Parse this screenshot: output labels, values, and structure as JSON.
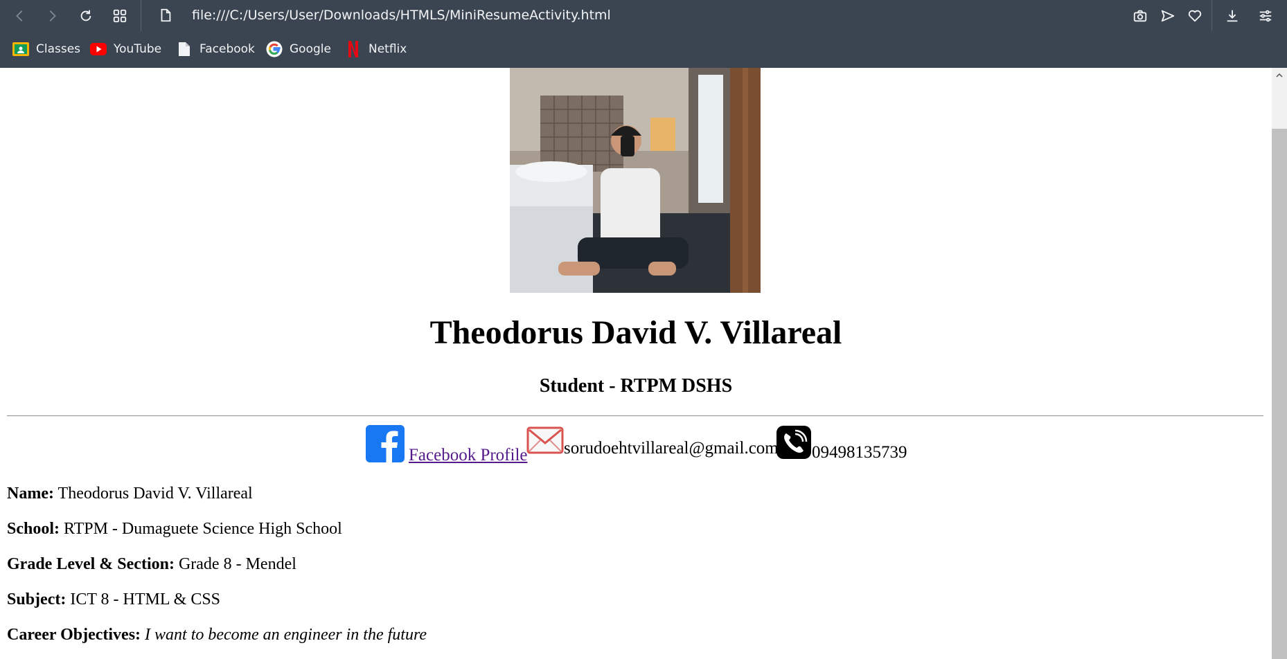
{
  "browser": {
    "url": "file:///C:/Users/User/Downloads/HTMLS/MiniResumeActivity.html",
    "bookmarks": [
      {
        "label": "Classes",
        "icon": "google-classroom-icon"
      },
      {
        "label": "YouTube",
        "icon": "youtube-icon"
      },
      {
        "label": "Facebook",
        "icon": "page-icon"
      },
      {
        "label": "Google",
        "icon": "google-icon"
      },
      {
        "label": "Netflix",
        "icon": "netflix-icon"
      }
    ]
  },
  "profile": {
    "full_name": "Theodorus David V. Villareal",
    "role": "Student - RTPM DSHS",
    "facebook_label": "Facebook Profile",
    "email": "sorudoehtvillareal@gmail.com",
    "phone": "09498135739"
  },
  "details": {
    "name_label": "Name:",
    "name_value": "Theodorus David V. Villareal",
    "school_label": "School:",
    "school_value": "RTPM - Dumaguete Science High School",
    "grade_label": "Grade Level & Section:",
    "grade_value": "Grade 8 - Mendel",
    "subject_label": "Subject:",
    "subject_value": "ICT 8 - HTML & CSS",
    "career_label": "Career Objectives:",
    "career_value": "I want to become an engineer in the future"
  },
  "colors": {
    "chrome_bg": "#3b4451",
    "link_visited": "#551a8b",
    "facebook_blue": "#1877f2"
  }
}
